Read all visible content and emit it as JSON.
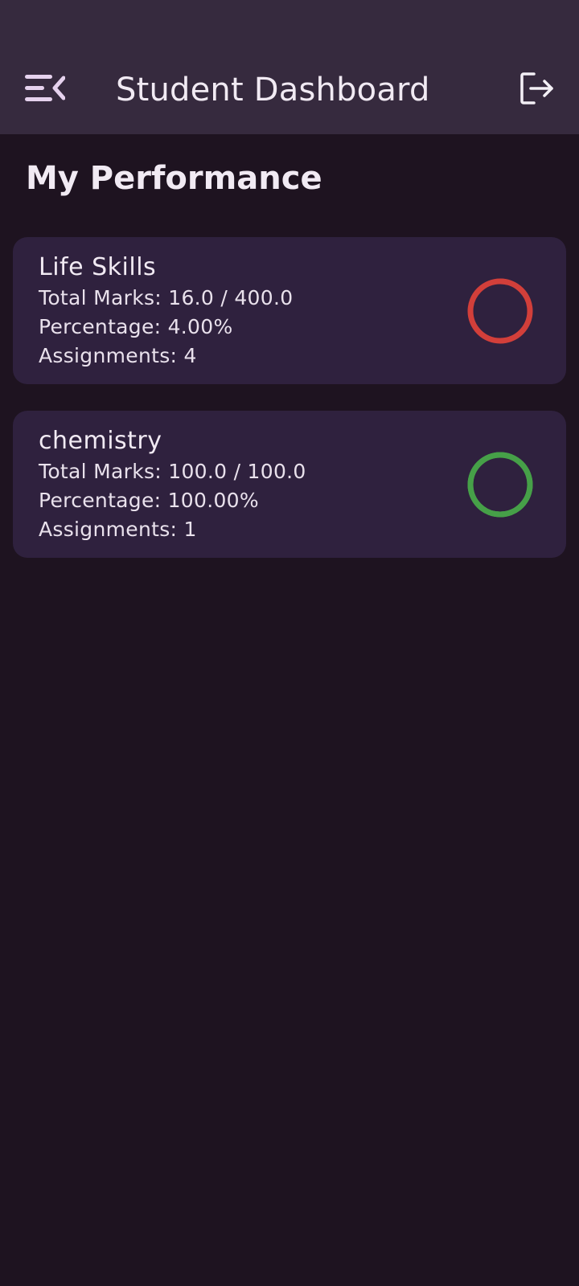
{
  "header": {
    "title": "Student Dashboard",
    "menu_icon": "menu-collapse-icon",
    "logout_icon": "logout-icon"
  },
  "section": {
    "title": "My Performance"
  },
  "courses": [
    {
      "name": "Life Skills",
      "total_marks": "Total Marks: 16.0 / 400.0",
      "percentage": "Percentage: 4.00%",
      "assignments": "Assignments: 4",
      "progress": 0.04,
      "color": "#d23f3a"
    },
    {
      "name": "chemistry",
      "total_marks": "Total Marks: 100.0 / 100.0",
      "percentage": "Percentage: 100.00%",
      "assignments": "Assignments: 1",
      "progress": 1.0,
      "color": "#46a048"
    }
  ],
  "colors": {
    "background": "#1e1320",
    "app_bar": "#362a3e",
    "card": "#2f213e",
    "low_score": "#d23f3a",
    "high_score": "#46a048"
  }
}
